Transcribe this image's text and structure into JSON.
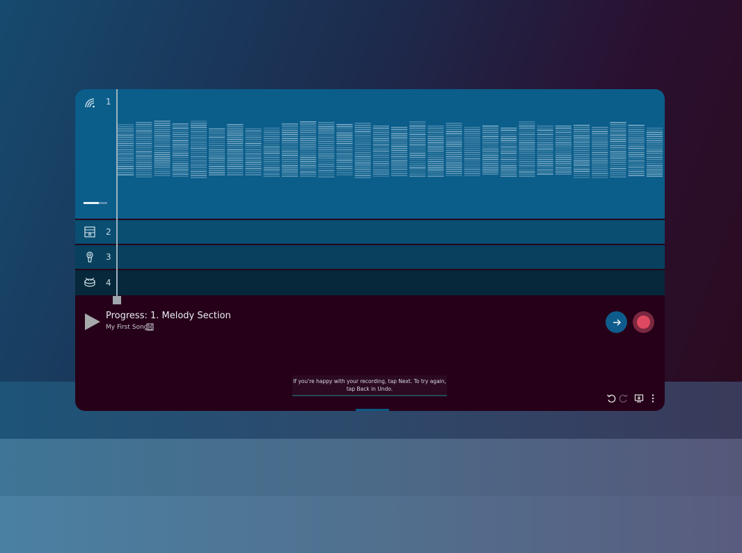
{
  "tracks": [
    {
      "number": "1",
      "icon": "wireless-sound-icon"
    },
    {
      "number": "2",
      "icon": "keyboard-icon"
    },
    {
      "number": "3",
      "icon": "microphone-icon"
    },
    {
      "number": "4",
      "icon": "drum-icon"
    }
  ],
  "track1_volume": 0.65,
  "player": {
    "progress_title": "Progress: 1. Melody Section",
    "song_name": "My First Song"
  },
  "tooltip": {
    "line1": "If you're happy with your recording, tap Next. To try again,",
    "line2": "tap Back in Undo."
  },
  "colors": {
    "track1": "#0b5d8a",
    "record": "#e04a60",
    "next": "#0e5c8c",
    "panel": "#260018"
  },
  "toolbar": [
    "undo-icon",
    "redo-icon",
    "import-icon",
    "more-icon"
  ]
}
